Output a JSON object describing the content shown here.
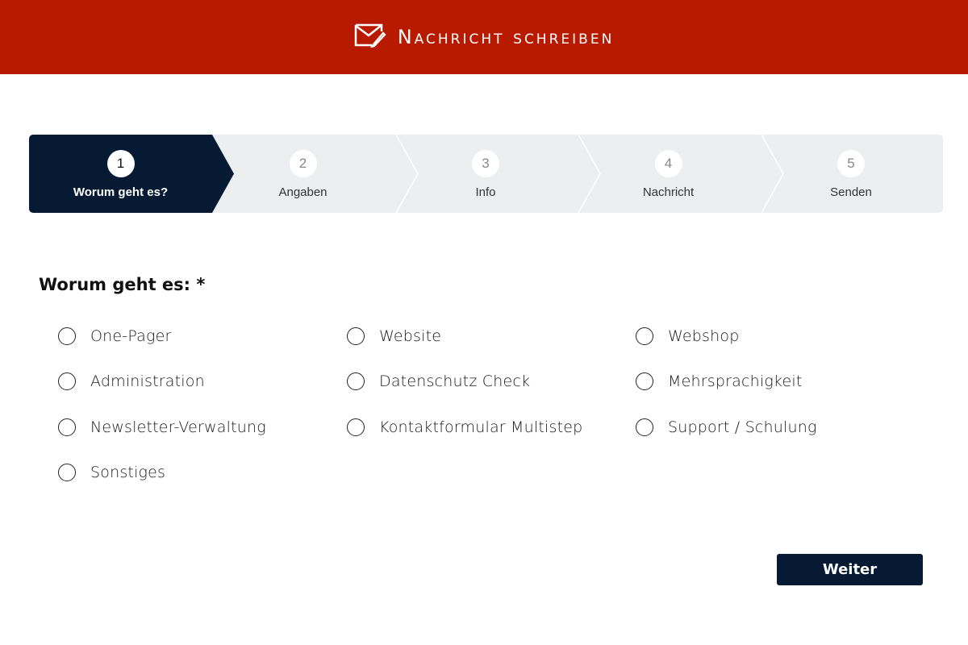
{
  "header": {
    "title": "Nachricht schreiben",
    "icon": "mail-pen-icon",
    "background": "#b81a00"
  },
  "stepper": {
    "active_index": 0,
    "active_color": "#061a33",
    "inactive_color": "#eceef0",
    "steps": [
      {
        "number": "1",
        "label": "Worum geht es?"
      },
      {
        "number": "2",
        "label": "Angaben"
      },
      {
        "number": "3",
        "label": "Info"
      },
      {
        "number": "4",
        "label": "Nachricht"
      },
      {
        "number": "5",
        "label": "Senden"
      }
    ]
  },
  "form": {
    "question": "Worum geht es: *",
    "options": [
      {
        "label": "One-Pager",
        "checked": false
      },
      {
        "label": "Website",
        "checked": false
      },
      {
        "label": "Webshop",
        "checked": false
      },
      {
        "label": "Administration",
        "checked": false
      },
      {
        "label": "Datenschutz Check",
        "checked": false
      },
      {
        "label": "Mehrsprachigkeit",
        "checked": false
      },
      {
        "label": "Newsletter-Verwaltung",
        "checked": false
      },
      {
        "label": "Kontaktformular Multistep",
        "checked": false
      },
      {
        "label": "Support / Schulung",
        "checked": false
      },
      {
        "label": "Sonstiges",
        "checked": false
      }
    ],
    "next_button": "Weiter"
  }
}
